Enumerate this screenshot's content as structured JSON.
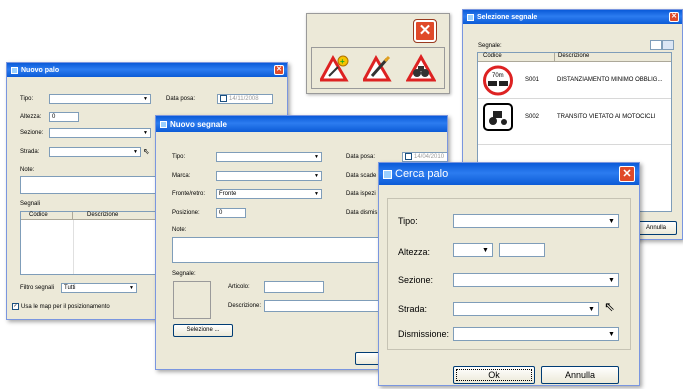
{
  "toolbar": {
    "icons": [
      "add-sign-icon",
      "edit-sign-icon",
      "find-sign-icon"
    ]
  },
  "nuovo_palo": {
    "title": "Nuovo palo",
    "tipo_label": "Tipo:",
    "altezza_label": "Altezza:",
    "altezza_value": "0",
    "sezione_label": "Sezione:",
    "strada_label": "Strada:",
    "note_label": "Note:",
    "data_posa_label": "Data posa:",
    "data_posa_value": "14/11/2008",
    "segnali_label": "Segnali",
    "col_codice": "Codice",
    "col_descrizione": "Descrizione",
    "filtro_label": "Filtro segnali",
    "filtro_value": "Tutti",
    "usa_map_label": "Usa le map per il posizionamento"
  },
  "nuovo_segnale": {
    "title": "Nuovo segnale",
    "tipo_label": "Tipo:",
    "marca_label": "Marca:",
    "fronte_label": "Fronte/retro:",
    "fronte_value": "Fronte",
    "posizione_label": "Posizione:",
    "posizione_value": "0",
    "note_label": "Note:",
    "data_posa_label": "Data posa:",
    "data_posa_value": "14/04/2010",
    "data_scade_label": "Data scade",
    "data_ispez_label": "Data ispezi",
    "data_dismis_label": "Data dismis",
    "segnale_label": "Segnale:",
    "articolo_label": "Articolo:",
    "descrizione_label": "Descrizione:",
    "selezione_button": "Selezione ..."
  },
  "selezione_segnale": {
    "title": "Selezione segnale",
    "segnale_label": "Segnale:",
    "col_codice": "Codice",
    "col_descrizione": "Descrizione",
    "rows": [
      {
        "codice": "S001",
        "descrizione": "DISTANZIAMENTO MINIMO OBBLIG...",
        "sign_text": "70m"
      },
      {
        "codice": "S002",
        "descrizione": "TRANSITO VIETATO AI MOTOCICLI"
      }
    ],
    "annulla_button": "Annulla"
  },
  "cerca_palo": {
    "title": "Cerca palo",
    "tipo_label": "Tipo:",
    "altezza_label": "Altezza:",
    "sezione_label": "Sezione:",
    "strada_label": "Strada:",
    "dismissione_label": "Dismissione:",
    "ok_button": "Ok",
    "annulla_button": "Annulla"
  }
}
